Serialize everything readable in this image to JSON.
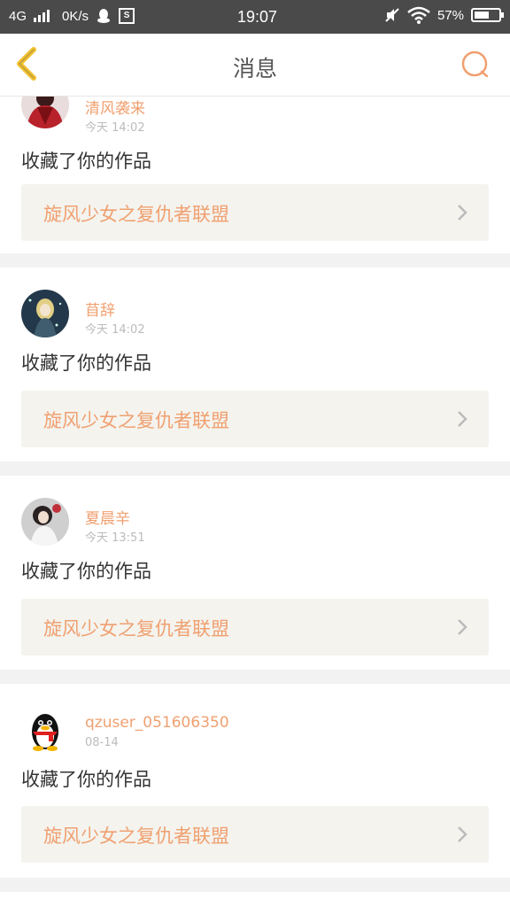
{
  "status_bar": {
    "network": "4G",
    "speed": "0K/s",
    "sim_icon": "S",
    "time": "19:07",
    "battery": "57%",
    "battery_level": 0.57,
    "icons": [
      "signal-icon",
      "qq-icon",
      "sim-icon",
      "mute-icon",
      "wifi-icon",
      "battery-icon"
    ]
  },
  "header": {
    "title": "消息",
    "back_icon": "chevron-left-icon",
    "search_icon": "search-icon"
  },
  "colors": {
    "accent": "#f0a070",
    "back": "#f2c12e",
    "card_bg": "#ffffff",
    "work_bg": "#f4f3ee",
    "page_bg": "#f2f2f2"
  },
  "messages": [
    {
      "user": "清风袭来",
      "time": "今天 14:02",
      "action": "收藏了你的作品",
      "work_title": "旋风少女之复仇者联盟",
      "avatar": "avatar-red-costume"
    },
    {
      "user": "苜辞",
      "time": "今天 14:02",
      "action": "收藏了你的作品",
      "work_title": "旋风少女之复仇者联盟",
      "avatar": "avatar-anime-girl"
    },
    {
      "user": "夏晨辛",
      "time": "今天 13:51",
      "action": "收藏了你的作品",
      "work_title": "旋风少女之复仇者联盟",
      "avatar": "avatar-girl-photo"
    },
    {
      "user": "qzuser_051606350",
      "time": "08-14",
      "action": "收藏了你的作品",
      "work_title": "旋风少女之复仇者联盟",
      "avatar": "qq-penguin-avatar"
    }
  ]
}
